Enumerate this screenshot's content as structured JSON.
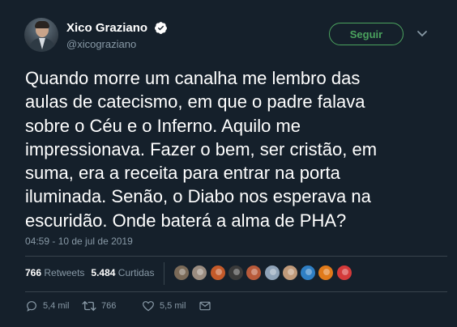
{
  "author": {
    "name": "Xico Graziano",
    "handle": "@xicograziano",
    "verified": true
  },
  "follow_button": {
    "label": "Seguir"
  },
  "tweet": {
    "lines": [
      "Quando morre um canalha me lembro das",
      "aulas de catecismo, em que o padre falava",
      "sobre o Céu e o Inferno. Aquilo me",
      "impressionava. Fazer o bem, ser cristão, em",
      "suma, era a receita para entrar na porta",
      "iluminada. Senão, o Diabo nos esperava na",
      "escuridão. Onde baterá a alma de PHA?"
    ],
    "timestamp": "04:59 - 10 de jul de 2019"
  },
  "stats": {
    "retweets_count": "766",
    "retweets_label": "Retweets",
    "likes_count": "5.484",
    "likes_label": "Curtidas"
  },
  "likers": [
    {
      "color": "#7a6a58"
    },
    {
      "color": "#9a8c80"
    },
    {
      "color": "#c45a2a"
    },
    {
      "color": "#3a3a3a"
    },
    {
      "color": "#b85a3a"
    },
    {
      "color": "#8fa3b8"
    },
    {
      "color": "#c09a7a"
    },
    {
      "color": "#2f7fc4"
    },
    {
      "color": "#e07a1a"
    },
    {
      "color": "#d43a3a"
    }
  ],
  "actions": {
    "reply_count": "5,4 mil",
    "retweet_count": "766",
    "like_count": "5,5 mil"
  },
  "colors": {
    "background": "#15202b",
    "accent_green": "#4ba35e",
    "muted": "#8899a6",
    "verified_blue": "#1da1f2"
  }
}
